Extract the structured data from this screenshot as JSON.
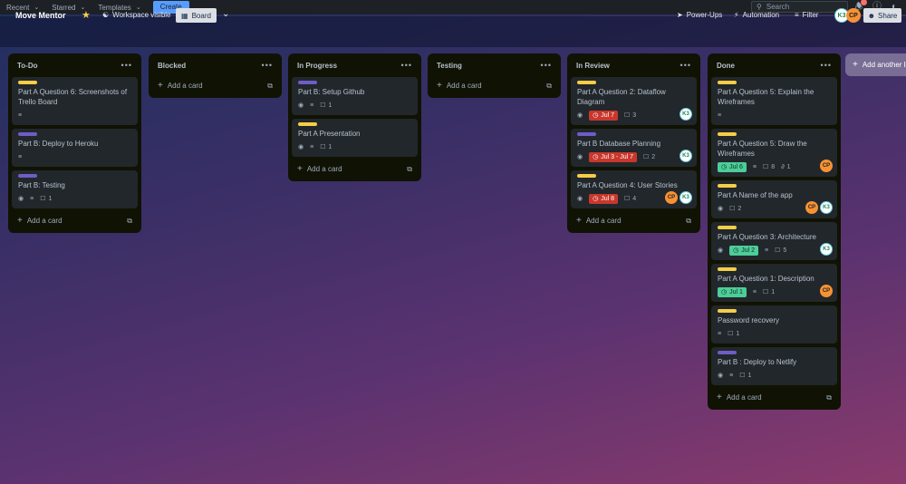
{
  "topnav": {
    "menus": [
      {
        "label": "Recent"
      },
      {
        "label": "Starred"
      },
      {
        "label": "Templates"
      }
    ],
    "create_label": "Create",
    "search_placeholder": "Search",
    "notification_count": "1"
  },
  "board": {
    "title": "Move Mentor",
    "visibility": "Workspace visible",
    "view_label": "Board",
    "powerups_label": "Power-Ups",
    "automation_label": "Automation",
    "filter_label": "Filter",
    "share_label": "Share",
    "members": [
      "K3",
      "CP"
    ]
  },
  "colors": {
    "label_yellow": "#f5cd47",
    "label_purple": "#6e5dc6",
    "due_overdue": "#c9372c",
    "due_complete": "#4bce97",
    "avatar_k3": "#ffffff",
    "avatar_cp": "#f79233"
  },
  "add_card_label": "Add a card",
  "add_list_label": "Add another list",
  "lists": [
    {
      "title": "To-Do",
      "cards": [
        {
          "label_color": "yellow",
          "title": "Part A Question 6: Screenshots of Trello Board",
          "watch": false,
          "description": true,
          "due": null,
          "comments": null,
          "attachments": null,
          "members": []
        },
        {
          "label_color": "purple",
          "title": "Part B: Deploy to Heroku",
          "watch": false,
          "description": true,
          "due": null,
          "comments": null,
          "attachments": null,
          "members": []
        },
        {
          "label_color": "purple",
          "title": "Part B: Testing",
          "watch": true,
          "description": true,
          "due": null,
          "comments": "1",
          "attachments": null,
          "members": []
        }
      ]
    },
    {
      "title": "Blocked",
      "cards": []
    },
    {
      "title": "In Progress",
      "cards": [
        {
          "label_color": "purple",
          "title": "Part B: Setup Github",
          "watch": true,
          "description": true,
          "due": null,
          "comments": "1",
          "attachments": null,
          "members": []
        },
        {
          "label_color": "yellow",
          "title": "Part A Presentation",
          "watch": true,
          "description": true,
          "due": null,
          "comments": "1",
          "attachments": null,
          "members": []
        }
      ]
    },
    {
      "title": "Testing",
      "cards": []
    },
    {
      "title": "In Review",
      "cards": [
        {
          "label_color": "yellow",
          "title": "Part A Question 2: Dataflow Diagram",
          "watch": true,
          "description": false,
          "due": {
            "text": "Jul 7",
            "status": "red"
          },
          "comments": "3",
          "attachments": null,
          "members": [
            "K3"
          ]
        },
        {
          "label_color": "purple",
          "title": "Part B Database Planning",
          "watch": true,
          "description": false,
          "due": {
            "text": "Jul 3 - Jul 7",
            "status": "red"
          },
          "comments": "2",
          "attachments": null,
          "members": [
            "K3"
          ]
        },
        {
          "label_color": "yellow",
          "title": "Part A Question 4: User Stories",
          "watch": true,
          "description": false,
          "due": {
            "text": "Jul 8",
            "status": "red"
          },
          "comments": "4",
          "attachments": null,
          "members": [
            "CP",
            "K3"
          ]
        }
      ]
    },
    {
      "title": "Done",
      "cards": [
        {
          "label_color": "yellow",
          "title": "Part A Question 5: Explain the Wireframes",
          "watch": false,
          "description": true,
          "due": null,
          "comments": null,
          "attachments": null,
          "members": []
        },
        {
          "label_color": "yellow",
          "title": "Part A Question 5: Draw the Wireframes",
          "watch": false,
          "description": true,
          "due": {
            "text": "Jul 6",
            "status": "green"
          },
          "comments": "8",
          "attachments": "1",
          "members": [
            "CP"
          ]
        },
        {
          "label_color": "yellow",
          "title": "Part A Name of the app",
          "watch": true,
          "description": false,
          "due": null,
          "comments": "2",
          "attachments": null,
          "members": [
            "CP",
            "K3"
          ]
        },
        {
          "label_color": "yellow",
          "title": "Part A Question 3: Architecture",
          "watch": true,
          "description": true,
          "due": {
            "text": "Jul 2",
            "status": "green"
          },
          "comments": "5",
          "attachments": null,
          "members": [
            "K3"
          ]
        },
        {
          "label_color": "yellow",
          "title": "Part A Question 1: Description",
          "watch": false,
          "description": true,
          "due": {
            "text": "Jul 1",
            "status": "green"
          },
          "comments": "1",
          "attachments": null,
          "members": [
            "CP"
          ]
        },
        {
          "label_color": "yellow",
          "title": "Password recovery",
          "watch": false,
          "description": true,
          "due": null,
          "comments": "1",
          "attachments": null,
          "members": []
        },
        {
          "label_color": "purple",
          "title": "Part B : Deploy to Netlify",
          "watch": true,
          "description": true,
          "due": null,
          "comments": "1",
          "attachments": null,
          "members": []
        }
      ]
    }
  ]
}
